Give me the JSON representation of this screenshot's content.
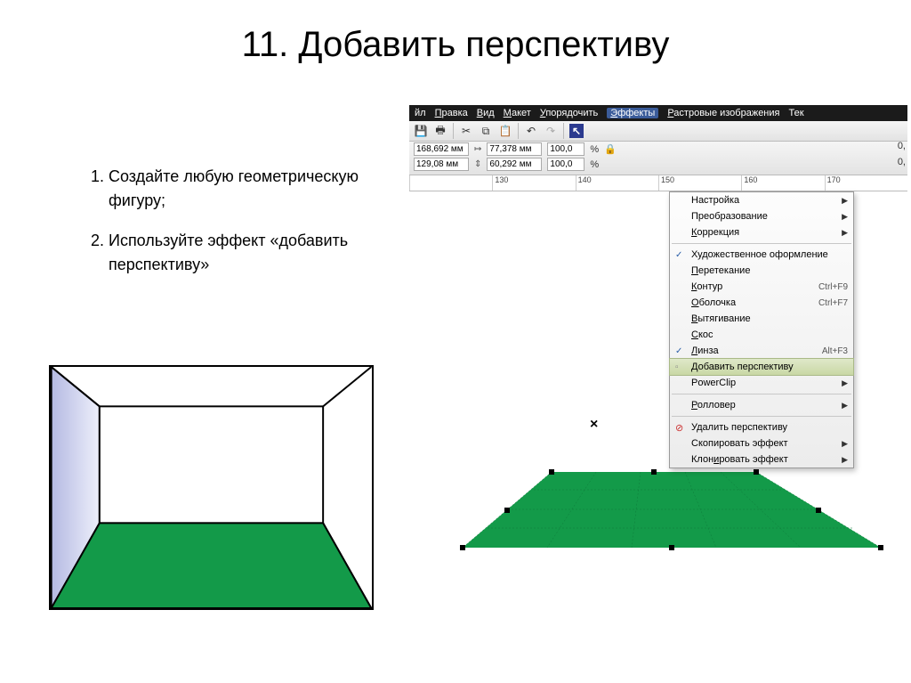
{
  "title": "11. Добавить перспективу",
  "steps": {
    "s1": "Создайте любую геометрическую фигуру;",
    "s2": "Используйте эффект «добавить перспективу»"
  },
  "menubar": {
    "file_tail": "йл",
    "edit": "Правка",
    "view": "Вид",
    "layout": "Макет",
    "arrange": "Упорядочить",
    "effects": "Эффекты",
    "bitmaps": "Растровые изображения",
    "text_tail": "Тек"
  },
  "toolbar2": {
    "x": "168,692 мм",
    "y": "129,08 мм",
    "w": "77,378 мм",
    "h": "60,292 мм",
    "p1": "100,0",
    "p2": "100,0",
    "pct": "%"
  },
  "ruler": {
    "t0": "",
    "t1": "130",
    "t2": "140",
    "t3": "150",
    "t4": "160",
    "t5": "170"
  },
  "right_nums": {
    "a": "0,",
    "b": "0,"
  },
  "dropdown": {
    "adjust": "Настройка",
    "transform": "Преобразование",
    "correction": "Коррекция",
    "artistic": "Художественное оформление",
    "blend": "Перетекание",
    "contour": "Контур",
    "contour_sc": "Ctrl+F9",
    "envelope": "Оболочка",
    "envelope_sc": "Ctrl+F7",
    "extrude": "Вытягивание",
    "bevel": "Скос",
    "lens": "Линза",
    "lens_sc": "Alt+F3",
    "add_perspective": "Добавить перспективу",
    "powerclip": "PowerClip",
    "rollover": "Ролловер",
    "clear_perspective": "Удалить перспективу",
    "copy_effect": "Скопировать эффект",
    "clone_effect": "Клонировать эффект"
  },
  "x_mark": "×"
}
